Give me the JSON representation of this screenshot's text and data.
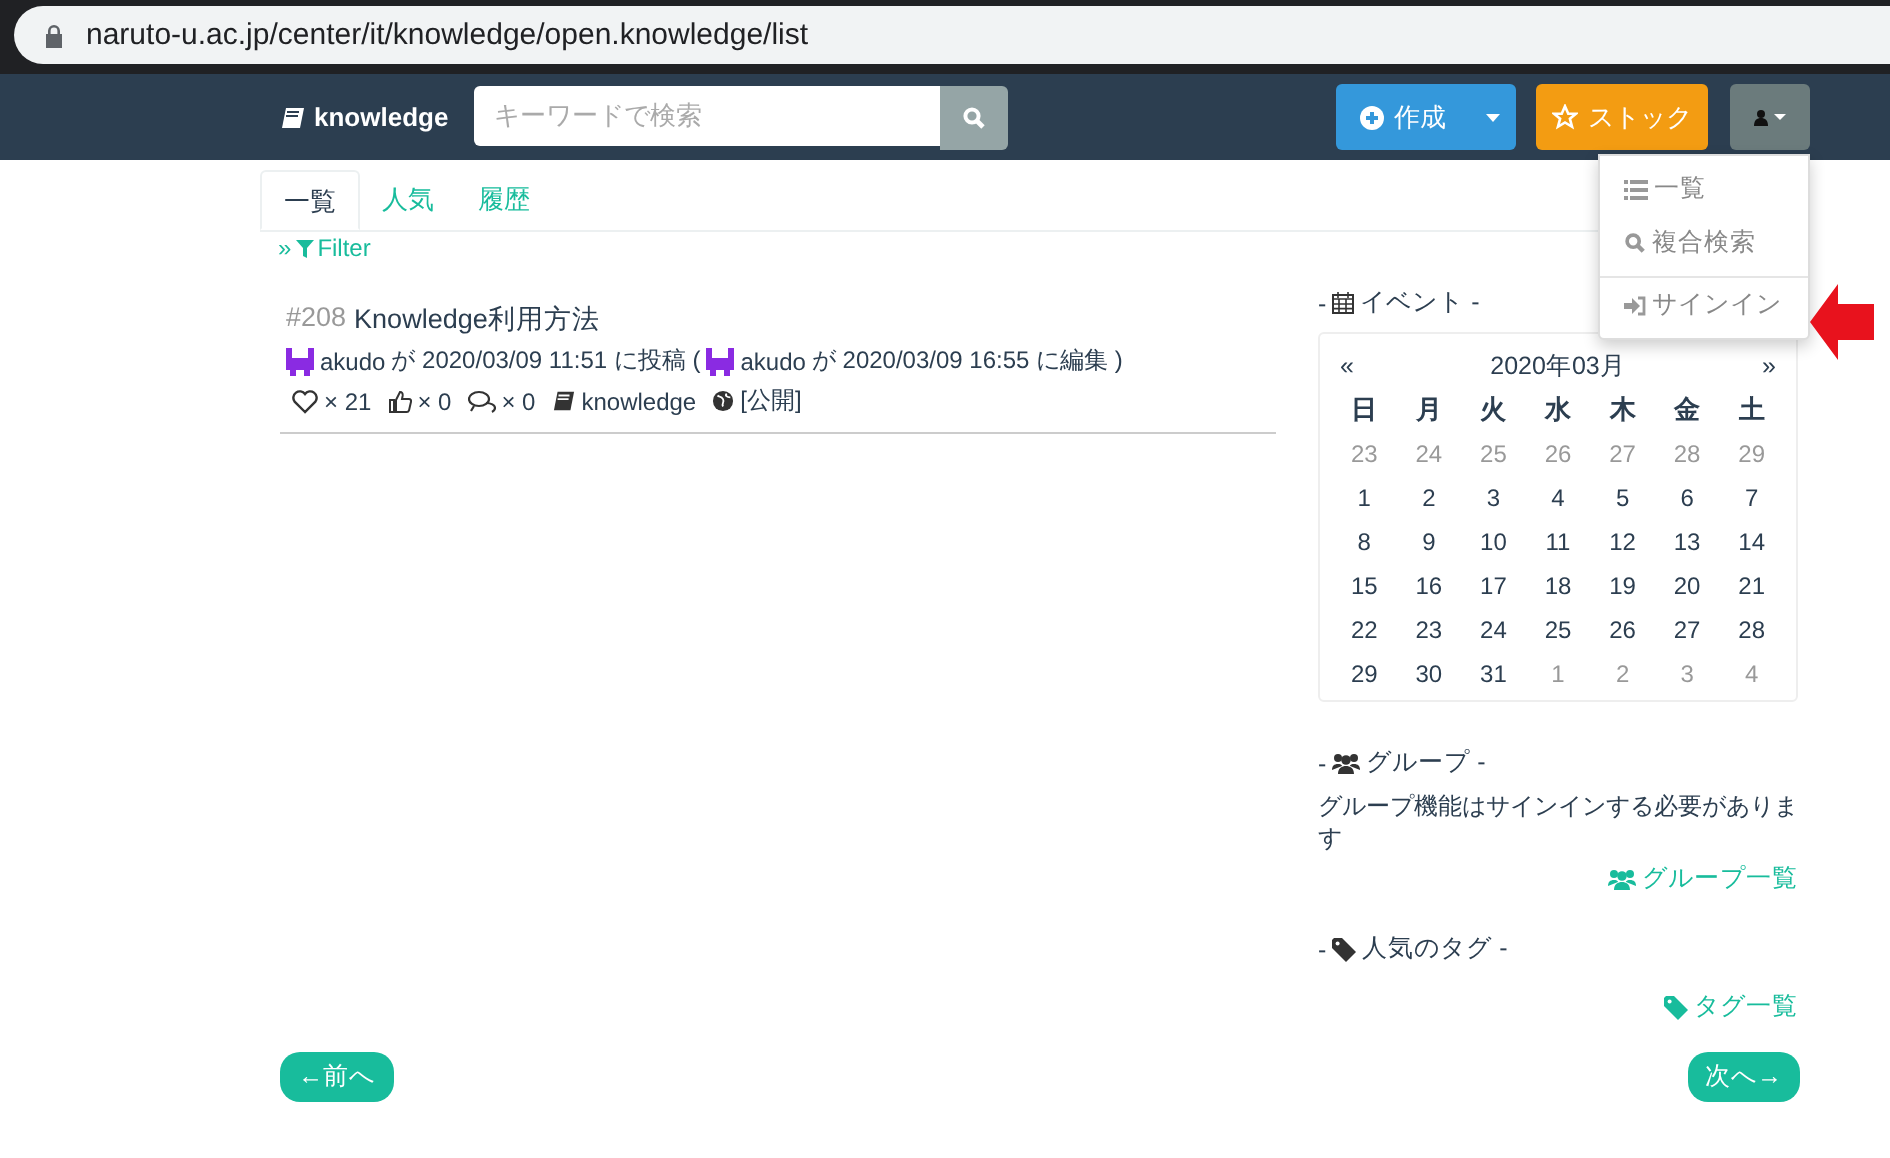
{
  "browser": {
    "url": "naruto-u.ac.jp/center/it/knowledge/open.knowledge/list"
  },
  "navbar": {
    "brand": "knowledge",
    "search": {
      "placeholder": "キーワードで検索"
    },
    "create": "作成",
    "stock": "ストック"
  },
  "user_menu": {
    "expanded": true,
    "items": [
      {
        "kind": "list",
        "label": "一覧"
      },
      {
        "kind": "search",
        "label": "複合検索"
      },
      {
        "kind": "signin",
        "label": "サインイン"
      }
    ]
  },
  "tabs": [
    {
      "label": "一覧",
      "selected": true
    },
    {
      "label": "人気",
      "selected": false
    },
    {
      "label": "履歴",
      "selected": false
    }
  ],
  "filter": {
    "prefix": "»",
    "label": "Filter"
  },
  "articles": [
    {
      "number": "#208",
      "title": "Knowledge利用方法",
      "author": "akudo",
      "posted": "が 2020/03/09 11:51 に投稿 (",
      "editor": "akudo",
      "edited": "が 2020/03/09 16:55 に編集 )",
      "likes": "× 21",
      "thumbs": "× 0",
      "comments": "× 0",
      "tag": "knowledge",
      "visibility": "[公開]"
    }
  ],
  "events": {
    "lead": "-",
    "label": "イベント -"
  },
  "calendar": {
    "prev": "«",
    "title": "2020年03月",
    "next": "»",
    "weekdays": [
      "日",
      "月",
      "火",
      "水",
      "木",
      "金",
      "土"
    ],
    "weeks": [
      [
        {
          "day": "23",
          "muted": true
        },
        {
          "day": "24",
          "muted": true
        },
        {
          "day": "25",
          "muted": true
        },
        {
          "day": "26",
          "muted": true
        },
        {
          "day": "27",
          "muted": true
        },
        {
          "day": "28",
          "muted": true
        },
        {
          "day": "29",
          "muted": true
        }
      ],
      [
        {
          "day": "1",
          "muted": false
        },
        {
          "day": "2",
          "muted": false
        },
        {
          "day": "3",
          "muted": false
        },
        {
          "day": "4",
          "muted": false
        },
        {
          "day": "5",
          "muted": false
        },
        {
          "day": "6",
          "muted": false
        },
        {
          "day": "7",
          "muted": false
        }
      ],
      [
        {
          "day": "8",
          "muted": false
        },
        {
          "day": "9",
          "muted": false
        },
        {
          "day": "10",
          "muted": false
        },
        {
          "day": "11",
          "muted": false
        },
        {
          "day": "12",
          "muted": false
        },
        {
          "day": "13",
          "muted": false
        },
        {
          "day": "14",
          "muted": false
        }
      ],
      [
        {
          "day": "15",
          "muted": false
        },
        {
          "day": "16",
          "muted": false
        },
        {
          "day": "17",
          "muted": false
        },
        {
          "day": "18",
          "muted": false
        },
        {
          "day": "19",
          "muted": false
        },
        {
          "day": "20",
          "muted": false
        },
        {
          "day": "21",
          "muted": false
        }
      ],
      [
        {
          "day": "22",
          "muted": false
        },
        {
          "day": "23",
          "muted": false
        },
        {
          "day": "24",
          "muted": false
        },
        {
          "day": "25",
          "muted": false
        },
        {
          "day": "26",
          "muted": false
        },
        {
          "day": "27",
          "muted": false
        },
        {
          "day": "28",
          "muted": false
        }
      ],
      [
        {
          "day": "29",
          "muted": false
        },
        {
          "day": "30",
          "muted": false
        },
        {
          "day": "31",
          "muted": false
        },
        {
          "day": "1",
          "muted": true
        },
        {
          "day": "2",
          "muted": true
        },
        {
          "day": "3",
          "muted": true
        },
        {
          "day": "4",
          "muted": true
        }
      ]
    ]
  },
  "group": {
    "lead": "-",
    "label": "グループ -",
    "note": "グループ機能はサインインする必要があります",
    "link": "グループ一覧"
  },
  "tags": {
    "lead": "-",
    "label": "人気のタグ -",
    "link": "タグ一覧"
  },
  "pager": {
    "prev": "←前へ",
    "next": "次へ→"
  }
}
